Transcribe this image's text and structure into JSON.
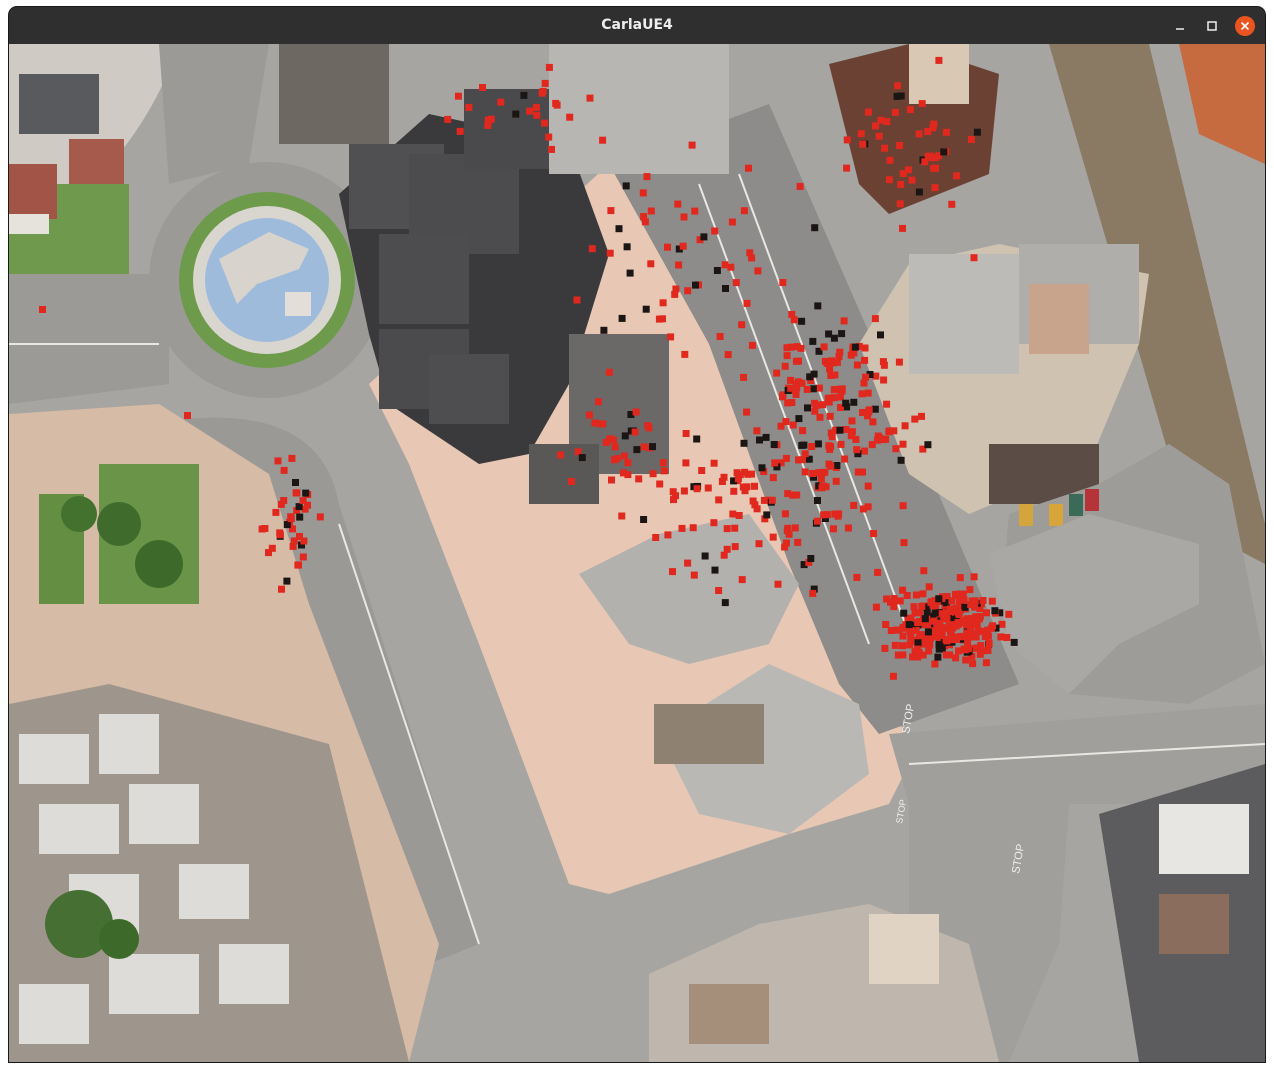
{
  "window": {
    "title": "CarlaUE4",
    "controls": {
      "minimize": "minimize-icon",
      "maximize": "maximize-icon",
      "close": "close-icon"
    }
  },
  "viewport": {
    "description": "Top-down rendered city scene with red point overlay",
    "road_markings": [
      "STOP",
      "STOP",
      "STOP"
    ]
  },
  "colors": {
    "titlebar": "#2f2f2f",
    "title_text": "#eeeeee",
    "close_button": "#e95420",
    "overlay_points": "#e0281e",
    "road": "#9c9b98",
    "plaza": "#e8c9b6",
    "grass": "#5f9147",
    "water": "#9db8d9",
    "building_dark": "#3b3b3b",
    "building_light": "#bdbcba"
  }
}
